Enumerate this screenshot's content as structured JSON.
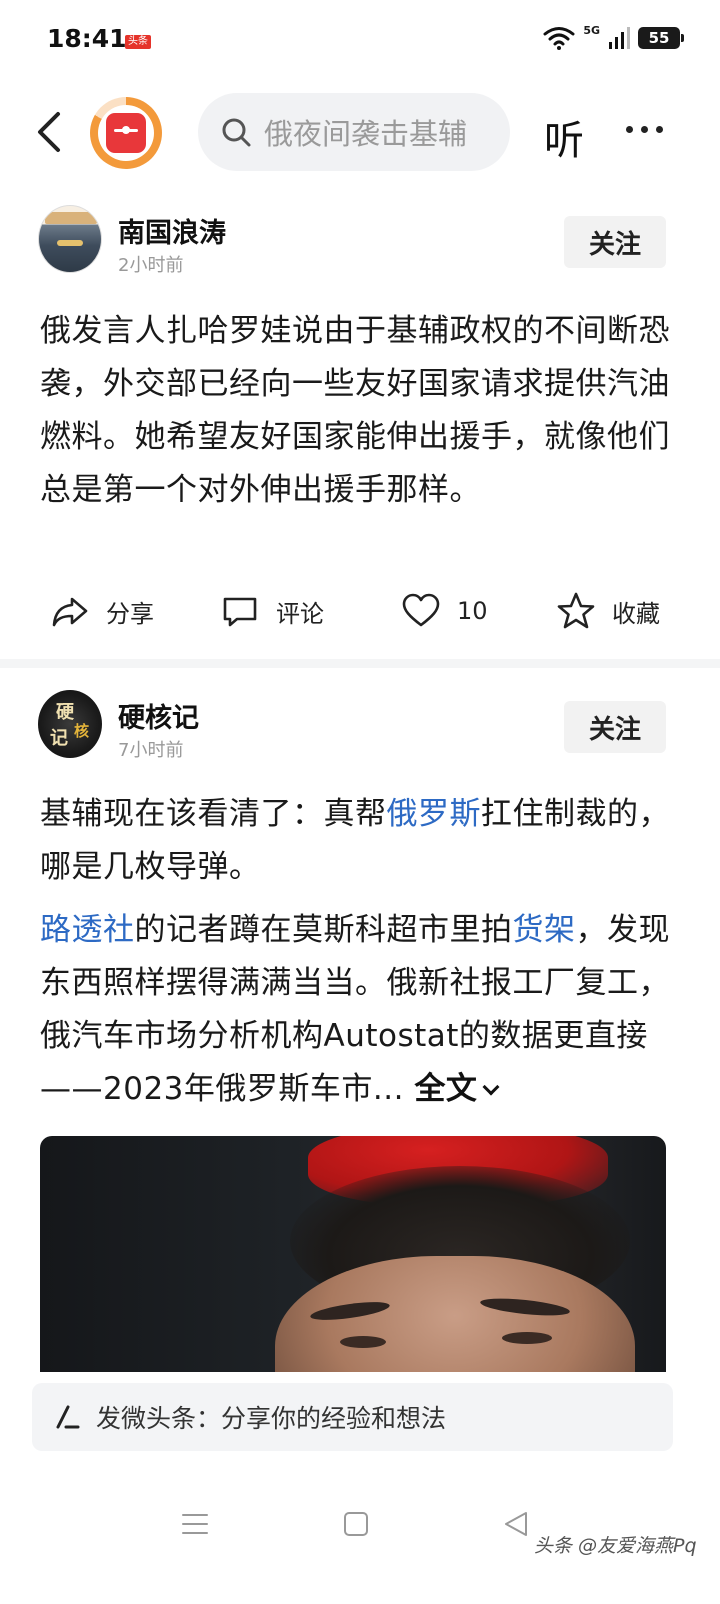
{
  "status_bar": {
    "time": "18:41",
    "app_badge": "头条",
    "network": "5G",
    "battery": "55"
  },
  "top_nav": {
    "search_placeholder": "俄夜间袭击基辅",
    "listen_label": "听"
  },
  "posts": [
    {
      "author": "南国浪涛",
      "time": "2小时前",
      "follow_label": "关注",
      "text": "俄发言人扎哈罗娃说由于基辅政权的不间断恐袭，外交部已经向一些友好国家请求提供汽油燃料。她希望友好国家能伸出援手，就像他们总是第一个对外伸出援手那样。",
      "actions": {
        "share": "分享",
        "comment": "评论",
        "like_count": "10",
        "favorite": "收藏"
      }
    },
    {
      "author": "硬核记",
      "avatar_glyphs": [
        "硬",
        "记",
        "核"
      ],
      "time": "7小时前",
      "follow_label": "关注",
      "para1": {
        "before": "基辅现在该看清了：真帮",
        "link": "俄罗斯",
        "after": "扛住制裁的，哪是几枚导弹。"
      },
      "para2": {
        "link1": "路透社",
        "mid": "的记者蹲在莫斯科超市里拍",
        "link2": "货架",
        "rest": "，发现东西照样摆得满满当当。俄新社报工厂复工，俄汽车市场分析机构Autostat的数据更直接——2023年俄罗斯车市...",
        "full_text_label": "全文"
      }
    }
  ],
  "composer": {
    "placeholder": "发微头条：分享你的经验和想法"
  },
  "watermark": "头条 @友爱海燕Pq",
  "colors": {
    "link": "#2d6ac4",
    "logo_red": "#e8373a",
    "logo_ring": "#f39a3b"
  }
}
